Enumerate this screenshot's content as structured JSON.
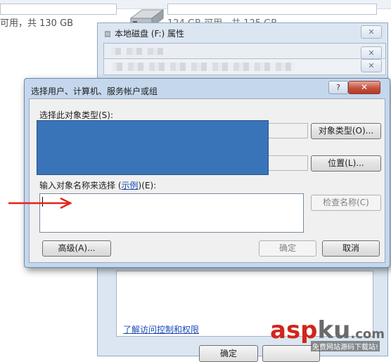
{
  "background": {
    "free_left": "可用，共 130 GB",
    "free_right": "124 GB 可用，共 125 GB"
  },
  "properties_window": {
    "title": "本地磁盘 (F:) 属性",
    "close_label": "✕",
    "link_text": "了解访问控制和权限",
    "ok_label": "确定"
  },
  "dialog": {
    "title": "选择用户、计算机、服务帐户或组",
    "help_label": "?",
    "close_label": "✕",
    "object_type_label": "选择此对象类型(S):",
    "object_type_button": "对象类型(O)...",
    "location_button": "位置(L)...",
    "enter_names_prefix": "输入对象名称来选择 (",
    "enter_names_link": "示例",
    "enter_names_suffix": ")(E):",
    "enter_names_value": "",
    "check_names_button": "检查名称(C)",
    "advanced_button": "高级(A)...",
    "ok_button": "确定",
    "cancel_button": "取消"
  },
  "watermark": {
    "brand_red": "asp",
    "brand_gray": "ku",
    "brand_suffix": ".com",
    "tagline": "免费网站源码下载站!"
  },
  "colors": {
    "accent_red": "#d0261c",
    "redaction_blue": "#3a74b8",
    "link_blue": "#1a4bb8",
    "title_bar": "#c4d7ec"
  }
}
